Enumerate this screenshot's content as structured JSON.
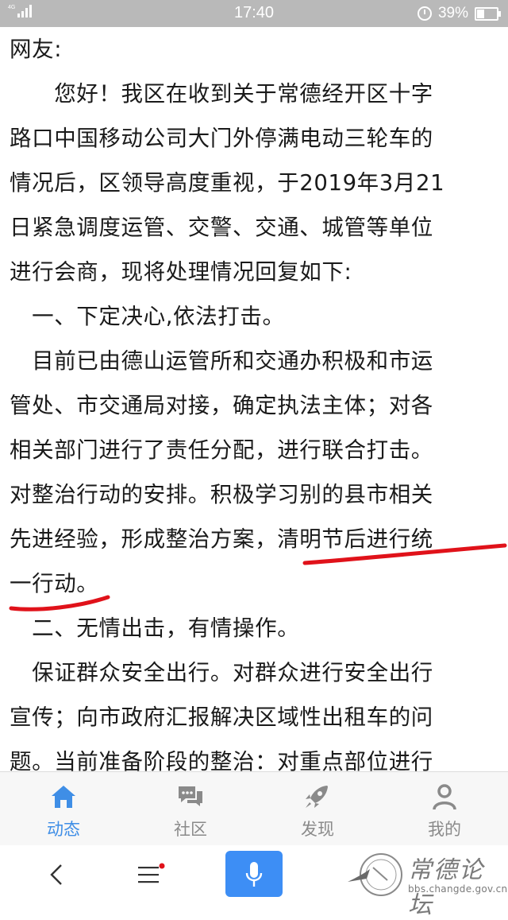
{
  "status_bar": {
    "network": "4G",
    "signal_bars": 4,
    "time": "17:40",
    "battery_percent_text": "39%",
    "battery_level": 0.39
  },
  "article": {
    "lines": [
      "网友:",
      "　　您好！我区在收到关于常德经开区十字",
      "路口中国移动公司大门外停满电动三轮车的",
      "情况后，区领导高度重视，于2019年3月21",
      "日紧急调度运管、交警、交通、城管等单位",
      "进行会商，现将处理情况回复如下:",
      "　一、下定决心,依法打击。",
      "　目前已由德山运管所和交通办积极和市运",
      "管处、市交通局对接，确定执法主体；对各",
      "相关部门进行了责任分配，进行联合打击。",
      "对整治行动的安排。积极学习别的县市相关",
      "先进经验，形成整治方案，清明节后进行统",
      "一行动。",
      "　二、无情出击，有情操作。",
      "　保证群众安全出行。对群众进行安全出行",
      "宣传；向市政府汇报解决区域性出租车的问",
      "题。当前准备阶段的整治：对重点部位进行"
    ],
    "annotation_color": "#e0121a"
  },
  "tab_bar": {
    "tabs": [
      {
        "label": "动态",
        "icon": "home-icon",
        "active": true
      },
      {
        "label": "社区",
        "icon": "chat-bubbles-icon",
        "active": false
      },
      {
        "label": "发现",
        "icon": "rocket-icon",
        "active": false
      },
      {
        "label": "我的",
        "icon": "user-icon",
        "active": false
      }
    ],
    "active_color": "#3f8ee6",
    "inactive_color": "#8a8a8a"
  },
  "nav_bar": {
    "back_icon": "chevron-left-icon",
    "menu_icon": "menu-icon",
    "mic_icon": "microphone-icon",
    "accent": "#3d8ef5"
  },
  "watermark": {
    "text": "常德论坛",
    "url": "bbs.changde.gov.cn"
  }
}
